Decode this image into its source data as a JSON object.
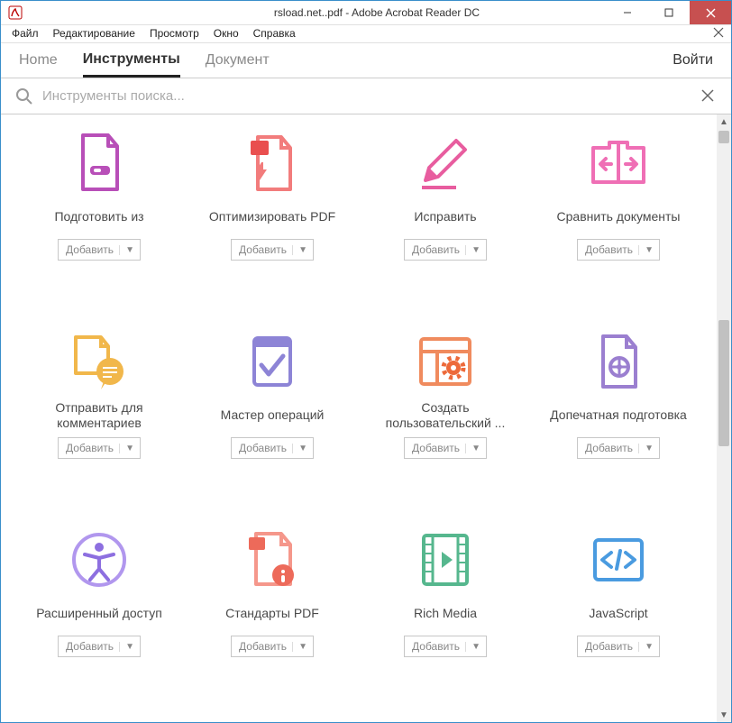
{
  "window": {
    "title": "rsload.net..pdf - Adobe Acrobat Reader DC"
  },
  "menus": {
    "file": "Файл",
    "edit": "Редактирование",
    "view": "Просмотр",
    "window": "Окно",
    "help": "Справка"
  },
  "tabs": {
    "home": "Home",
    "tools": "Инструменты",
    "document": "Документ",
    "login": "Войти"
  },
  "search": {
    "placeholder": "Инструменты поиска..."
  },
  "add_label": "Добавить",
  "tools": [
    {
      "label": "Подготовить из",
      "icon": "prepare"
    },
    {
      "label": "Оптимизировать PDF",
      "icon": "optimize"
    },
    {
      "label": "Исправить",
      "icon": "redact"
    },
    {
      "label": "Сравнить документы",
      "icon": "compare"
    },
    {
      "label": "Отправить для комментариев",
      "icon": "send-comments"
    },
    {
      "label": "Мастер операций",
      "icon": "action-wizard"
    },
    {
      "label": "Создать пользовательский ...",
      "icon": "custom-tool"
    },
    {
      "label": "Допечатная подготовка",
      "icon": "preflight"
    },
    {
      "label": "Расширенный доступ",
      "icon": "accessibility"
    },
    {
      "label": "Стандарты PDF",
      "icon": "standards"
    },
    {
      "label": "Rich Media",
      "icon": "rich-media"
    },
    {
      "label": "JavaScript",
      "icon": "javascript"
    }
  ]
}
